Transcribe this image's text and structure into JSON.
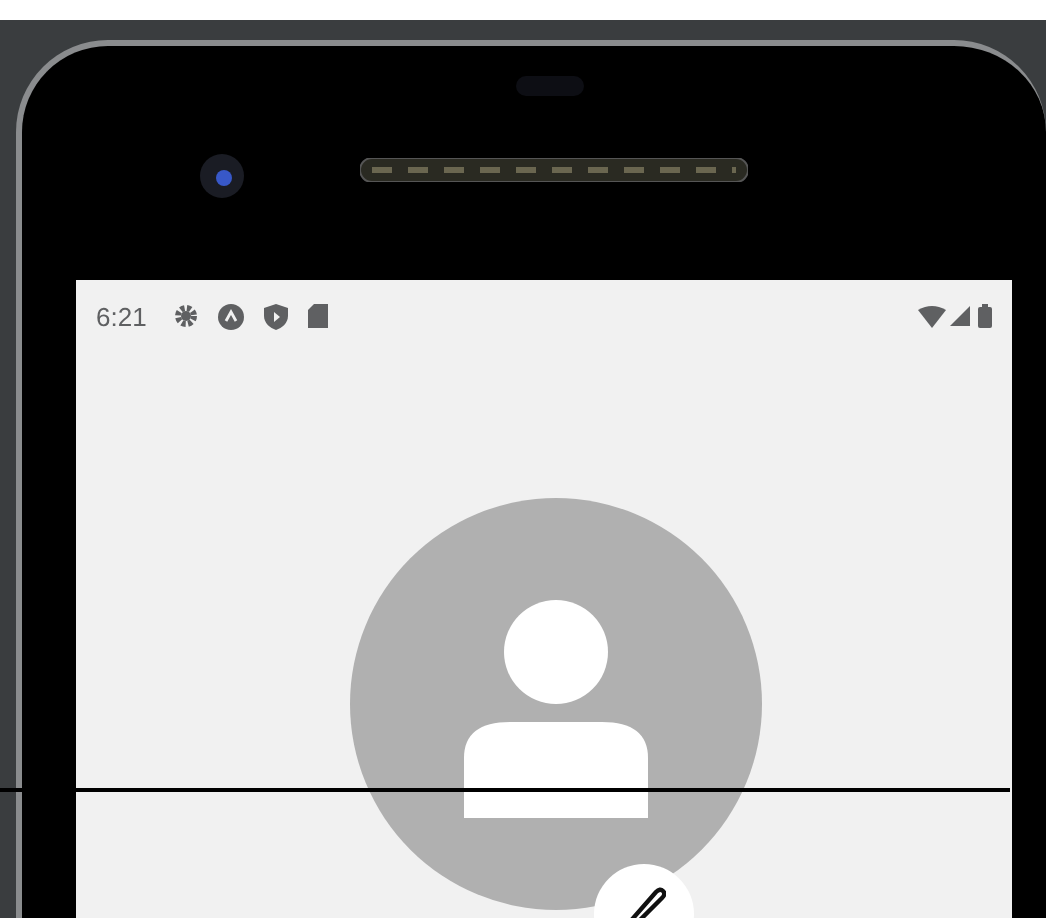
{
  "status_bar": {
    "time": "6:21"
  }
}
